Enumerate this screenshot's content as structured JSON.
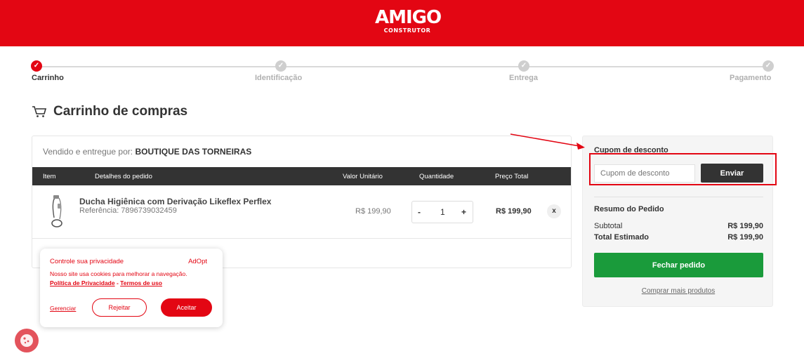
{
  "header": {
    "logo_main": "AMIGO",
    "logo_sub": "CONSTRUTOR",
    "brand_color": "#e30613"
  },
  "steps": [
    {
      "label": "Carrinho",
      "active": true
    },
    {
      "label": "Identificação",
      "active": false
    },
    {
      "label": "Entrega",
      "active": false
    },
    {
      "label": "Pagamento",
      "active": false
    }
  ],
  "cart": {
    "title": "Carrinho de compras",
    "seller_prefix": "Vendido e entregue por:",
    "seller_name": "BOUTIQUE DAS TORNEIRAS",
    "columns": [
      "Item",
      "Detalhes do pedido",
      "Valor Unitário",
      "Quantidade",
      "Preço Total"
    ],
    "item": {
      "name": "Ducha Higiênica com Derivação Likeflex Perflex",
      "reference": "Referência: 7896739032459",
      "unit_price": "R$ 199,90",
      "quantity": "1",
      "minus": "-",
      "plus": "+",
      "total_price": "R$ 199,90",
      "remove": "x"
    }
  },
  "sidebar": {
    "coupon_title": "Cupom de desconto",
    "coupon_placeholder": "Cupom de desconto",
    "coupon_button": "Enviar",
    "summary_title": "Resumo do Pedido",
    "subtotal_label": "Subtotal",
    "subtotal_value": "R$ 199,90",
    "total_label": "Total Estimado",
    "total_value": "R$ 199,90",
    "checkout_button": "Fechar pedido",
    "more_products": "Comprar mais produtos"
  },
  "cookie_banner": {
    "title": "Controle sua privacidade",
    "brand": "AdOpt",
    "text": "Nosso site usa cookies para melhorar a navegação.",
    "privacy_link": "Política de Privacidade",
    "separator": " - ",
    "terms_link": "Termos de uso",
    "manage": "Gerenciar",
    "reject": "Rejeitar",
    "accept": "Aceitar"
  }
}
